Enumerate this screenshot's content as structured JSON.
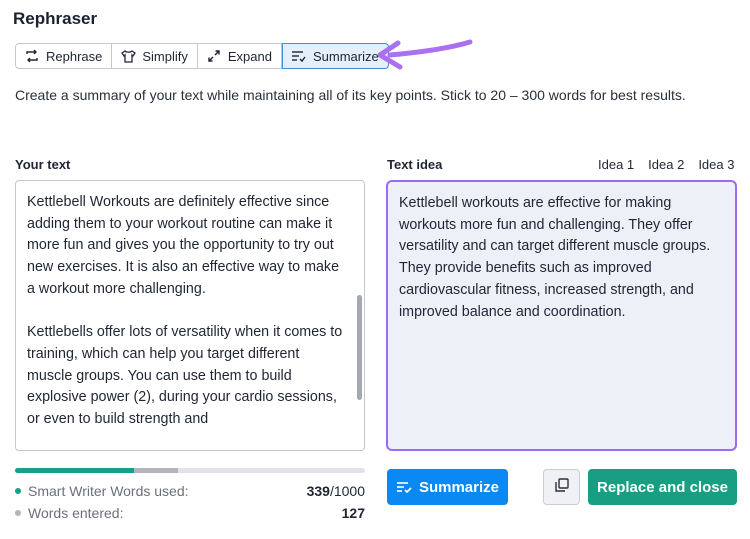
{
  "app": {
    "title": "Rephraser"
  },
  "modes": [
    {
      "label": "Rephrase",
      "icon": "rephrase-icon"
    },
    {
      "label": "Simplify",
      "icon": "simplify-icon"
    },
    {
      "label": "Expand",
      "icon": "expand-icon"
    },
    {
      "label": "Summarize",
      "icon": "summarize-icon",
      "active": true
    }
  ],
  "description": "Create a summary of your text while maintaining all of its key points. Stick to 20 – 300 words for best results.",
  "input": {
    "label": "Your text",
    "paragraphs": [
      "Kettlebell Workouts are definitely effective since adding them to your workout routine can make it more fun and gives you the opportunity to try out new exercises. It is also an effective way to make a workout more challenging.",
      "Kettlebells offer lots of versatility when it comes to training, which can help you target different muscle groups. You can use them to build explosive power (2), during your cardio sessions, or even to build strength and"
    ]
  },
  "output": {
    "label": "Text idea",
    "ideas": [
      "Idea 1",
      "Idea 2",
      "Idea 3"
    ],
    "text": "Kettlebell workouts are effective for making workouts more fun and challenging. They offer versatility and can target different muscle groups. They provide benefits such as improved cardiovascular fitness, increased strength, and improved balance and coordination."
  },
  "stats": {
    "words_used_label": "Smart Writer Words used:",
    "words_used": "339",
    "words_limit": "/1000",
    "words_entered_label": "Words entered:",
    "words_entered": "127",
    "used_color": "#189f8b",
    "entered_color": "#b2b5bd"
  },
  "buttons": {
    "summarize": "Summarize",
    "copy": "copy-icon",
    "replace": "Replace and close"
  },
  "colors": {
    "accent": "#0b89f3",
    "replace": "#189f83",
    "highlight": "#9b6cf0",
    "annotation_arrow": "#a970f0"
  }
}
